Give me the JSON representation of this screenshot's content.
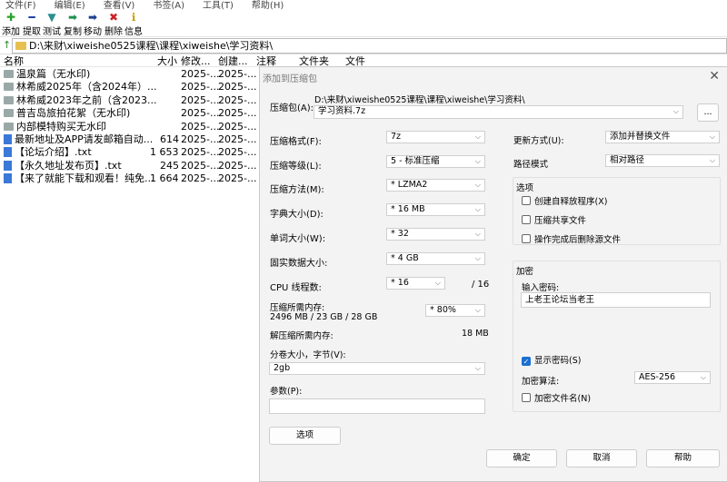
{
  "menu": [
    "文件(F)",
    "编辑(E)",
    "查看(V)",
    "书签(A)",
    "工具(T)",
    "帮助(H)"
  ],
  "toolbar": [
    {
      "label": "添加",
      "glyph": "✚",
      "color": "#2aa12a"
    },
    {
      "label": "提取",
      "glyph": "━",
      "color": "#1b3fa8"
    },
    {
      "label": "测试",
      "glyph": "▼",
      "color": "#2a8f8f"
    },
    {
      "label": "复制",
      "glyph": "➡",
      "color": "#1f8f4f"
    },
    {
      "label": "移动",
      "glyph": "➡",
      "color": "#1b3f8f"
    },
    {
      "label": "删除",
      "glyph": "✖",
      "color": "#cc2222"
    },
    {
      "label": "信息",
      "glyph": "ℹ",
      "color": "#c8a000"
    }
  ],
  "address": "D:\\来财\\xiweishe0525课程\\课程\\xiweishe\\学习资料\\",
  "columns": {
    "name": "名称",
    "size": "大小",
    "modified": "修改...",
    "created": "创建...",
    "comment": "注释",
    "folders": "文件夹",
    "files": "文件"
  },
  "files": [
    {
      "type": "folder",
      "name": "温泉篇（无水印)",
      "size": "",
      "modified": "2025-...",
      "created": "2025-..."
    },
    {
      "type": "folder",
      "name": "林希威2025年（含2024年）...",
      "size": "",
      "modified": "2025-...",
      "created": "2025-..."
    },
    {
      "type": "folder",
      "name": "林希威2023年之前（含2023...",
      "size": "",
      "modified": "2025-...",
      "created": "2025-..."
    },
    {
      "type": "folder",
      "name": "普吉岛旅拍花絮（无水印)",
      "size": "",
      "modified": "2025-...",
      "created": "2025-..."
    },
    {
      "type": "folder",
      "name": "内部模特购买无水印",
      "size": "",
      "modified": "2025-...",
      "created": "2025-..."
    },
    {
      "type": "file",
      "name": "最新地址及APP请发邮箱自动...",
      "size": "614",
      "modified": "2025-...",
      "created": "2025-..."
    },
    {
      "type": "file",
      "name": "【论坛介绍】.txt",
      "size": "1 653",
      "modified": "2025-...",
      "created": "2025-..."
    },
    {
      "type": "file",
      "name": "【永久地址发布页】.txt",
      "size": "245",
      "modified": "2025-...",
      "created": "2025-..."
    },
    {
      "type": "file",
      "name": "【来了就能下载和观看！纯免...",
      "size": "1 664",
      "modified": "2025-...",
      "created": "2025-..."
    }
  ],
  "dialog": {
    "title": "添加到压缩包",
    "archive_label": "压缩包(A):",
    "archive_dir": "D:\\来财\\xiweishe0525课程\\课程\\xiweishe\\学习资料\\",
    "archive_name": "学习资料.7z",
    "browse": "...",
    "format_label": "压缩格式(F):",
    "format": "7z",
    "level_label": "压缩等级(L):",
    "level": "5 - 标准压缩",
    "method_label": "压缩方法(M):",
    "method": "*  LZMA2",
    "dict_label": "字典大小(D):",
    "dict": "*  16 MB",
    "word_label": "单词大小(W):",
    "word": "*  32",
    "solid_label": "固实数据大小:",
    "solid": "*  4 GB",
    "cpu_label": "CPU 线程数:",
    "cpu": "*  16",
    "cpu_max": "/ 16",
    "mem_comp_label": "压缩所需内存:",
    "mem_comp": "2496 MB / 23 GB / 28 GB",
    "mem_pct": "* 80%",
    "mem_decomp_label": "解压缩所需内存:",
    "mem_decomp": "18 MB",
    "split_label": "分卷大小，字节(V):",
    "split": "2gb",
    "params_label": "参数(P):",
    "params": "",
    "options_btn": "选项",
    "update_label": "更新方式(U):",
    "update": "添加并替换文件",
    "path_label": "路径模式",
    "path": "相对路径",
    "opts_title": "选项",
    "opt_sfx": "创建自释放程序(X)",
    "opt_shared": "压缩共享文件",
    "opt_delete": "操作完成后删除源文件",
    "enc_title": "加密",
    "pwd_label": "输入密码:",
    "pwd": "上老王论坛当老王",
    "show_pwd": "显示密码(S)",
    "enc_method_label": "加密算法:",
    "enc_method": "AES-256",
    "enc_names": "加密文件名(N)",
    "ok": "确定",
    "cancel": "取消",
    "help": "帮助"
  }
}
